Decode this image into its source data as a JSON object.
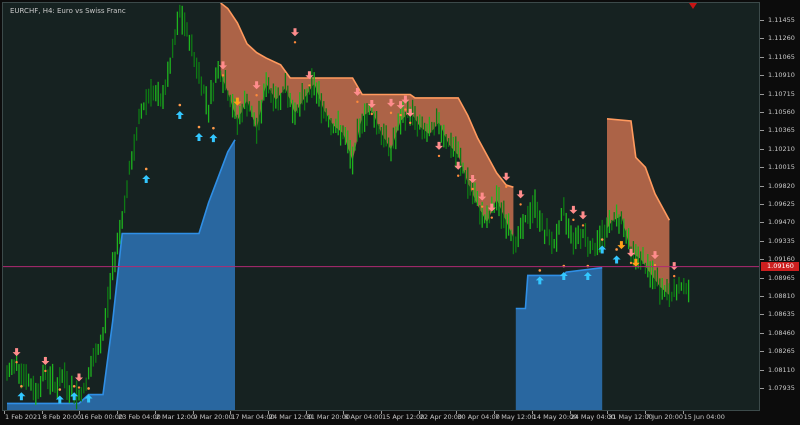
{
  "window": {
    "title": "EURCHF, H4: Euro vs Swiss Franc"
  },
  "colors": {
    "background": "#162221",
    "bull_bar": "#1eb41e",
    "bear_bar": "#0e7a14",
    "support_line": "#2f8fe6",
    "support_fill": "#2a6ba8",
    "resistance_line": "#ff9a5e",
    "resistance_fill": "#b4674a",
    "up_arrow": "#33c7ff",
    "down_arrow": "#ff8c8c",
    "hline": "#b02a72",
    "price_tag": "#cc1f1f"
  },
  "price_axis": {
    "labels": [
      "1.11455",
      "1.11260",
      "1.11065",
      "1.10910",
      "1.10715",
      "1.10560",
      "1.10365",
      "1.10210",
      "1.10015",
      "1.09820",
      "1.09625",
      "1.09470",
      "1.09335",
      "1.09160",
      "1.08965",
      "1.08810",
      "1.08635",
      "1.08460",
      "1.08265",
      "1.08110",
      "1.07935"
    ],
    "current_price": "1.09160"
  },
  "time_axis": {
    "labels": [
      "1 Feb 2021",
      "8 Feb 20:00",
      "16 Feb 00:00",
      "23 Feb 04:00",
      "2 Mar 12:00",
      "9 Mar 20:00",
      "17 Mar 04:00",
      "24 Mar 12:00",
      "31 Mar 20:00",
      "8 Apr 04:00",
      "15 Apr 12:00",
      "22 Apr 20:00",
      "30 Apr 04:00",
      "7 May 12:00",
      "14 May 20:00",
      "24 May 04:00",
      "31 May 12:00",
      "7 Jun 20:00",
      "15 Jun 04:00"
    ]
  },
  "chart_data": {
    "type": "candlestick",
    "symbol": "EURCHF",
    "timeframe": "H4",
    "title": "EURCHF, H4: Euro vs Swiss Franc",
    "ylim": [
      1.0786,
      1.1155
    ],
    "x_labels": [
      "1 Feb 2021",
      "8 Feb 20:00",
      "16 Feb 00:00",
      "23 Feb 04:00",
      "2 Mar 12:00",
      "9 Mar 20:00",
      "17 Mar 04:00",
      "24 Mar 12:00",
      "31 Mar 20:00",
      "8 Apr 04:00",
      "15 Apr 12:00",
      "22 Apr 20:00",
      "30 Apr 04:00",
      "7 May 12:00",
      "14 May 20:00",
      "24 May 04:00",
      "31 May 12:00",
      "7 Jun 20:00",
      "15 Jun 04:00"
    ],
    "current_price": 1.0916,
    "price_path": [
      [
        0,
        1.0817
      ],
      [
        4,
        1.083
      ],
      [
        8,
        1.0815
      ],
      [
        12,
        1.0802
      ],
      [
        16,
        1.0822
      ],
      [
        20,
        1.0808
      ],
      [
        24,
        1.0816
      ],
      [
        28,
        1.0798
      ],
      [
        32,
        1.0804
      ],
      [
        36,
        1.083
      ],
      [
        40,
        1.0853
      ],
      [
        44,
        1.0914
      ],
      [
        48,
        1.0962
      ],
      [
        52,
        1.1012
      ],
      [
        56,
        1.1058
      ],
      [
        60,
        1.1077
      ],
      [
        64,
        1.1063
      ],
      [
        68,
        1.1097
      ],
      [
        72,
        1.1145
      ],
      [
        76,
        1.1122
      ],
      [
        80,
        1.109
      ],
      [
        84,
        1.1062
      ],
      [
        88,
        1.1097
      ],
      [
        92,
        1.1074
      ],
      [
        96,
        1.1048
      ],
      [
        100,
        1.1067
      ],
      [
        104,
        1.104
      ],
      [
        108,
        1.1082
      ],
      [
        112,
        1.1067
      ],
      [
        116,
        1.1078
      ],
      [
        120,
        1.1055
      ],
      [
        124,
        1.1069
      ],
      [
        128,
        1.1082
      ],
      [
        132,
        1.1058
      ],
      [
        136,
        1.1044
      ],
      [
        140,
        1.1037
      ],
      [
        144,
        1.1012
      ],
      [
        148,
        1.1052
      ],
      [
        152,
        1.1058
      ],
      [
        156,
        1.1037
      ],
      [
        160,
        1.1022
      ],
      [
        164,
        1.1048
      ],
      [
        168,
        1.1057
      ],
      [
        172,
        1.1043
      ],
      [
        176,
        1.1036
      ],
      [
        180,
        1.1047
      ],
      [
        184,
        1.1027
      ],
      [
        188,
        1.1017
      ],
      [
        192,
        1.0992
      ],
      [
        196,
        1.0972
      ],
      [
        200,
        1.0956
      ],
      [
        204,
        1.0977
      ],
      [
        208,
        1.0957
      ],
      [
        212,
        1.0937
      ],
      [
        216,
        1.0957
      ],
      [
        220,
        1.0972
      ],
      [
        224,
        1.0947
      ],
      [
        228,
        1.0937
      ],
      [
        232,
        1.0964
      ],
      [
        236,
        1.0942
      ],
      [
        240,
        1.0947
      ],
      [
        244,
        1.0932
      ],
      [
        248,
        1.0944
      ],
      [
        252,
        1.0957
      ],
      [
        256,
        1.0962
      ],
      [
        260,
        1.0929
      ],
      [
        264,
        1.0923
      ],
      [
        268,
        1.091
      ],
      [
        272,
        1.0898
      ],
      [
        276,
        1.089
      ],
      [
        280,
        1.0895
      ],
      [
        284,
        1.09
      ]
    ],
    "support_level": [
      [
        0,
        1.0792
      ],
      [
        30,
        1.0792
      ],
      [
        34,
        1.08
      ],
      [
        40,
        1.08
      ],
      [
        44,
        1.0866
      ],
      [
        48,
        1.0946
      ],
      [
        80,
        1.0946
      ],
      [
        84,
        1.0974
      ],
      [
        88,
        1.0997
      ],
      [
        92,
        1.102
      ],
      [
        95,
        1.1031
      ],
      [
        96,
        null
      ],
      [
        212,
        null
      ],
      [
        212,
        1.0878
      ],
      [
        216,
        1.0878
      ],
      [
        217,
        1.0908
      ],
      [
        232,
        1.0908
      ],
      [
        233,
        1.0911
      ],
      [
        248,
        1.0915
      ],
      [
        249,
        null
      ]
    ],
    "resistance_level": [
      [
        89,
        1.1155
      ],
      [
        92,
        1.115
      ],
      [
        96,
        1.1137
      ],
      [
        100,
        1.1118
      ],
      [
        104,
        1.111
      ],
      [
        108,
        1.1105
      ],
      [
        114,
        1.1099
      ],
      [
        118,
        1.1087
      ],
      [
        144,
        1.1087
      ],
      [
        148,
        1.1072
      ],
      [
        168,
        1.1072
      ],
      [
        170,
        1.1069
      ],
      [
        188,
        1.1069
      ],
      [
        192,
        1.1053
      ],
      [
        196,
        1.1033
      ],
      [
        200,
        1.1017
      ],
      [
        204,
        1.1001
      ],
      [
        208,
        1.099
      ],
      [
        211,
        1.0988
      ],
      [
        212,
        null
      ],
      [
        250,
        null
      ],
      [
        250,
        1.105
      ],
      [
        260,
        1.1048
      ],
      [
        262,
        1.1015
      ],
      [
        266,
        1.1006
      ],
      [
        270,
        1.0982
      ],
      [
        276,
        1.0958
      ]
    ],
    "signals_up": [
      [
        6,
        1.0803
      ],
      [
        22,
        1.08
      ],
      [
        28,
        1.0803
      ],
      [
        34,
        1.0801
      ],
      [
        58,
        1.1
      ],
      [
        72,
        1.1058
      ],
      [
        80,
        1.1038
      ],
      [
        86,
        1.1037
      ],
      [
        222,
        1.0908
      ],
      [
        232,
        1.0912
      ],
      [
        242,
        1.0912
      ],
      [
        248,
        1.0936
      ],
      [
        254,
        1.0927
      ]
    ],
    "signals_down": [
      [
        4,
        1.0833
      ],
      [
        16,
        1.0825
      ],
      [
        30,
        1.081
      ],
      [
        90,
        1.1093
      ],
      [
        104,
        1.1075
      ],
      [
        120,
        1.1123
      ],
      [
        126,
        1.1084
      ],
      [
        146,
        1.1069
      ],
      [
        152,
        1.1058
      ],
      [
        160,
        1.1059
      ],
      [
        164,
        1.1057
      ],
      [
        166,
        1.1062
      ],
      [
        168,
        1.105
      ],
      [
        180,
        1.102
      ],
      [
        188,
        1.1002
      ],
      [
        194,
        1.099
      ],
      [
        198,
        1.0974
      ],
      [
        202,
        1.0964
      ],
      [
        208,
        1.0992
      ],
      [
        214,
        1.0976
      ],
      [
        236,
        1.0962
      ],
      [
        240,
        1.0957
      ],
      [
        260,
        1.0923
      ],
      [
        270,
        1.0921
      ],
      [
        278,
        1.0911
      ]
    ],
    "signals_caution": [
      [
        96,
        1.1061
      ],
      [
        256,
        1.0931
      ],
      [
        262,
        1.0915
      ]
    ]
  }
}
